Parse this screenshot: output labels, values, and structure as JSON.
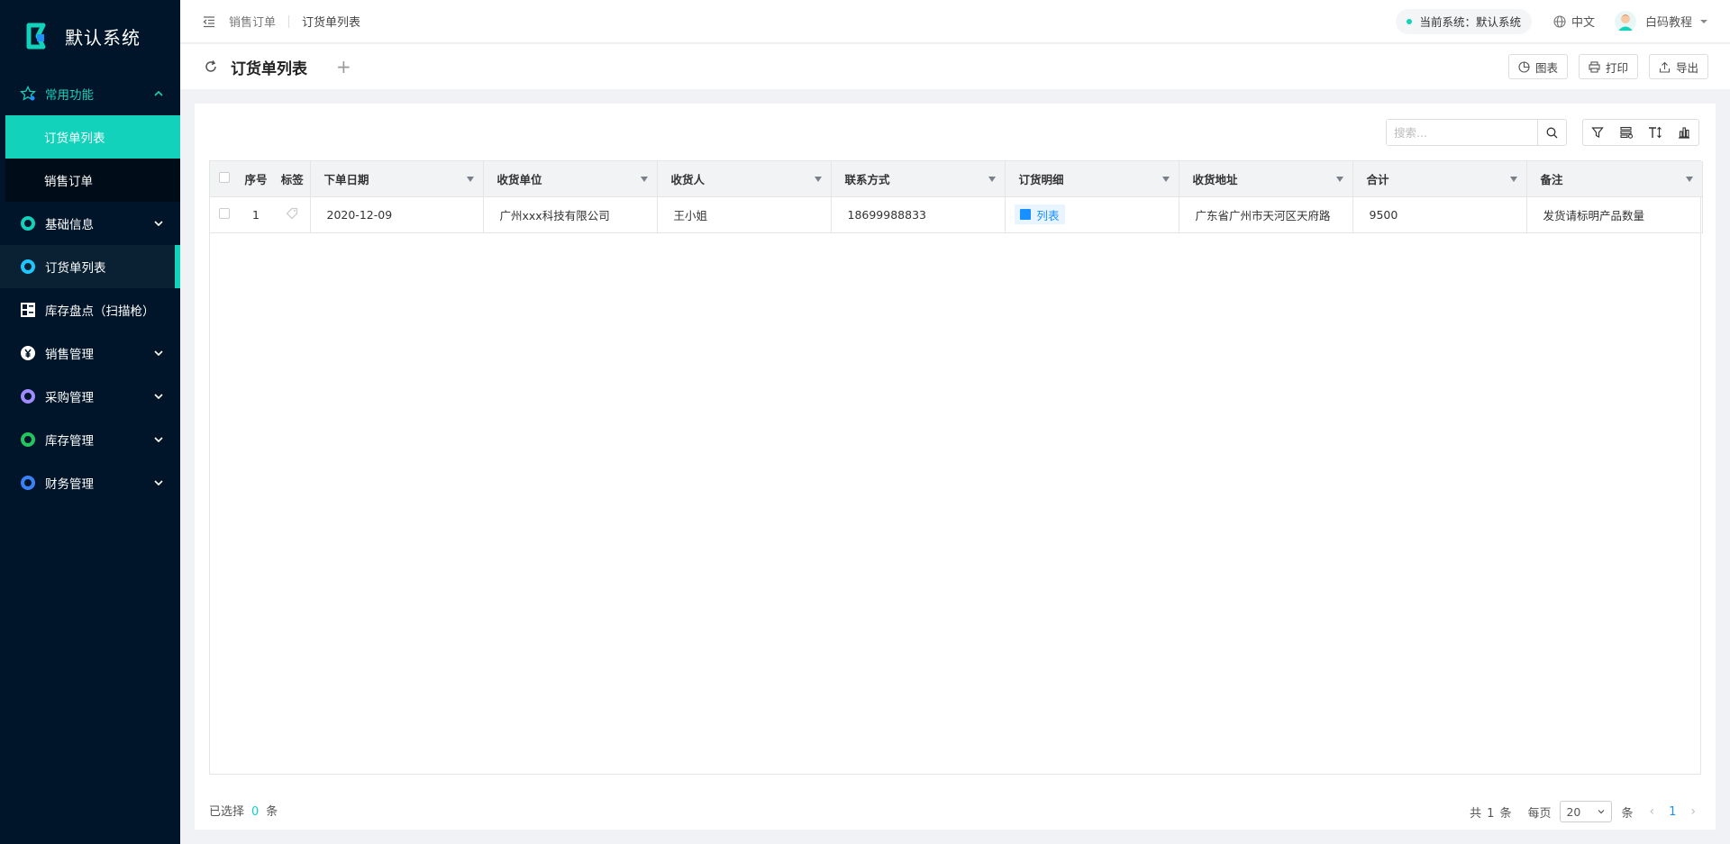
{
  "app": {
    "name": "默认系统",
    "brand_color": "#12d2bc"
  },
  "sidebar": {
    "groups": [
      {
        "label": "常用功能",
        "icon": "star-icon",
        "open": true,
        "items": [
          {
            "label": "订货单列表"
          },
          {
            "label": "销售订单"
          }
        ]
      },
      {
        "label": "基础信息",
        "icon": "ring-icon",
        "color": "#12d2bc"
      },
      {
        "label": "订货单列表",
        "icon": "ring-icon",
        "color": "#1ec8ff",
        "active": true
      },
      {
        "label": "库存盘点（扫描枪）",
        "icon": "grid-icon"
      },
      {
        "label": "销售管理",
        "icon": "yen-icon"
      },
      {
        "label": "采购管理",
        "icon": "ring-icon",
        "color": "#9f8bff"
      },
      {
        "label": "库存管理",
        "icon": "ring-icon",
        "color": "#22c55e"
      },
      {
        "label": "财务管理",
        "icon": "ring-icon",
        "color": "#3b82f6"
      }
    ]
  },
  "header": {
    "breadcrumb": [
      "销售订单",
      "订货单列表"
    ],
    "current_system": "当前系统：默认系统",
    "language": "中文",
    "user": "白码教程"
  },
  "page": {
    "title": "订货单列表",
    "buttons": {
      "chart": "图表",
      "print": "打印",
      "export": "导出"
    }
  },
  "toolbar": {
    "search_placeholder": "搜索..."
  },
  "table": {
    "headers": {
      "index": "序号",
      "tag": "标签",
      "date": "下单日期",
      "unit": "收货单位",
      "receiver": "收货人",
      "contact": "联系方式",
      "detail": "订货明细",
      "address": "收货地址",
      "total": "合计",
      "remark": "备注"
    },
    "rows": [
      {
        "index": "1",
        "date": "2020-12-09",
        "unit": "广州xxx科技有限公司",
        "receiver": "王小姐",
        "contact": "18699988833",
        "detail": "列表",
        "address": "广东省广州市天河区天府路",
        "total": "9500",
        "remark": "发货请标明产品数量"
      }
    ]
  },
  "footer": {
    "selected_prefix": "已选择",
    "selected_count": "0",
    "selected_suffix": "条",
    "total_prefix": "共",
    "total_count": "1",
    "total_suffix": "条",
    "per_page_label": "每页",
    "page_size": "20",
    "per_page_suffix": "条",
    "current_page": "1"
  }
}
